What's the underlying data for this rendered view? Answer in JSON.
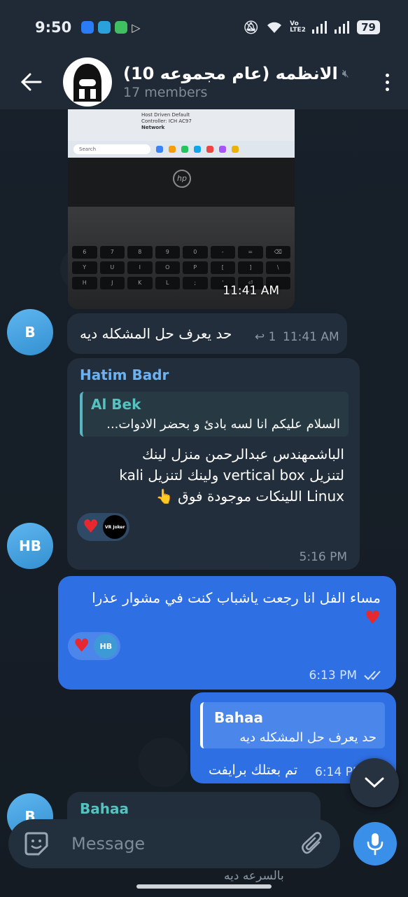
{
  "status_bar": {
    "time": "9:50",
    "net_label": "Vo LTE2",
    "battery": "79"
  },
  "header": {
    "title": "الانظمه (عام مجموعه 10)",
    "subtitle": "17 members"
  },
  "messages": {
    "photo": {
      "time": "11:41 AM",
      "screen_lines": [
        "Host Driven   Default",
        "Controller:   ICH AC97",
        "Network"
      ],
      "search": "Search"
    },
    "m1": {
      "avatar": "B",
      "text": "حد يعرف حل المشكله ديه",
      "reply_count": "1",
      "time": "11:41 AM"
    },
    "m2": {
      "avatar": "HB",
      "sender": "Hatim Badr",
      "quote_name": "Al Bek",
      "quote_text": "السلام عليكم انا لسه بادئ و بحضر الادوات...",
      "line1": "الباشمهندس عبدالرحمن منزل لينك",
      "line2": "لتنزيل vertical box ولينك لتنزيل kali",
      "line3": "Linux اللينكات موجودة فوق 👆",
      "reaction_avatar": "VR Joker",
      "time": "5:16 PM"
    },
    "m3": {
      "text": "مساء الفل انا رجعت ياشباب كنت في مشوار عذرا",
      "reaction_avatar": "HB",
      "time": "6:13 PM"
    },
    "m4": {
      "quote_name": "Bahaa",
      "quote_text": "حد يعرف حل المشكله ديه",
      "text": "تم بعتلك برايفت",
      "time": "6:14 PM"
    },
    "m5": {
      "avatar": "B",
      "sender": "Bahaa",
      "preview": "بالسرعه ديه"
    }
  },
  "composer": {
    "placeholder": "Message"
  },
  "colors": {
    "outgoing": "#2f6fe4",
    "incoming": "#222e3b",
    "accent": "#3a8fe8",
    "heart": "#e8282f"
  }
}
